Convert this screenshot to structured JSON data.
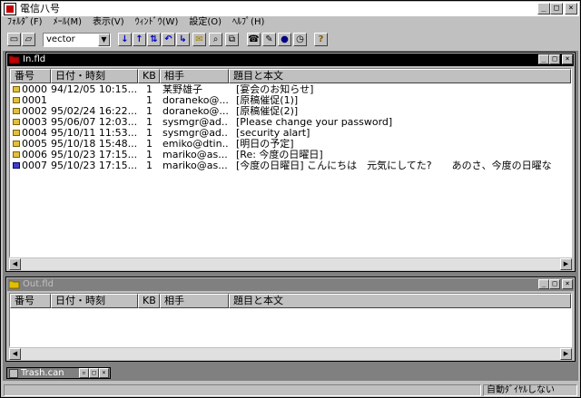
{
  "app": {
    "title": "電信八号"
  },
  "menu": [
    {
      "label": "ﾌｫﾙﾀﾞ(F)"
    },
    {
      "label": "ﾒｰﾙ(M)"
    },
    {
      "label": "表示(V)"
    },
    {
      "label": "ｳｨﾝﾄﾞｳ(W)"
    },
    {
      "label": "設定(O)"
    },
    {
      "label": "ﾍﾙﾌﾟ(H)"
    }
  ],
  "toolbar": {
    "combo_value": "vector",
    "help_glyph": "?"
  },
  "inbox": {
    "title": "In.fld",
    "columns": [
      "番号",
      "日付・時刻",
      "KB",
      "相手",
      "題目と本文"
    ],
    "rows": [
      {
        "num": "0000",
        "date": "94/12/05 10:15...",
        "kb": "1",
        "from": "某野雄子",
        "subject": "[宴会のお知らせ]"
      },
      {
        "num": "0001",
        "date": "",
        "kb": "1",
        "from": "doraneko@...",
        "subject": "[原稿催促(1)]"
      },
      {
        "num": "0002",
        "date": "95/02/24 16:22...",
        "kb": "1",
        "from": "doraneko@...",
        "subject": "[原稿催促(2)]"
      },
      {
        "num": "0003",
        "date": "95/06/07 12:03...",
        "kb": "1",
        "from": "sysmgr@ad...",
        "subject": "[Please change your password]"
      },
      {
        "num": "0004",
        "date": "95/10/11 11:53...",
        "kb": "1",
        "from": "sysmgr@ad...",
        "subject": "[security alart]"
      },
      {
        "num": "0005",
        "date": "95/10/18 15:48...",
        "kb": "1",
        "from": "emiko@dtin...",
        "subject": "[明日の予定]"
      },
      {
        "num": "0006",
        "date": "95/10/23 17:15...",
        "kb": "1",
        "from": "mariko@as...",
        "subject": "[Re: 今度の日曜日]"
      },
      {
        "num": "0007",
        "date": "95/10/23 17:15...",
        "kb": "1",
        "from": "mariko@as...",
        "subject": "[今度の日曜日] こんにちは　元気にしてた?　　あのさ、今度の日曜な"
      }
    ]
  },
  "outbox": {
    "title": "Out.fld",
    "columns": [
      "番号",
      "日付・時刻",
      "KB",
      "相手",
      "題目と本文"
    ]
  },
  "trash": {
    "title": "Trash.can"
  },
  "status": {
    "dial": "自動ﾀﾞｲﾔﾙしない"
  },
  "colors": {
    "active_caption": "#000000",
    "inactive_caption": "#808080",
    "face": "#c0c0c0"
  }
}
